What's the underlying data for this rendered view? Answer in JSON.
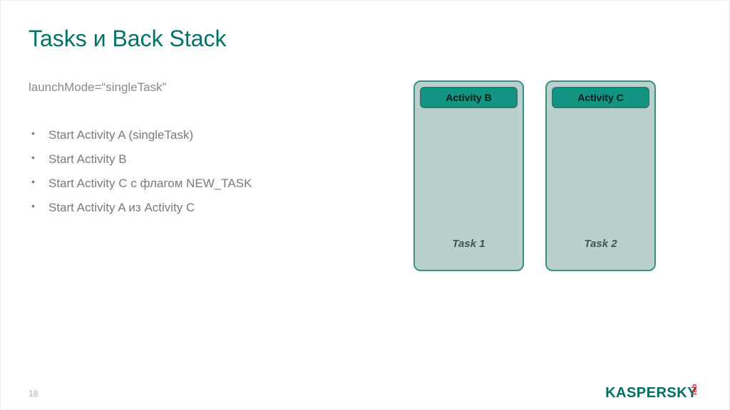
{
  "title": "Tasks и Back Stack",
  "launch_mode": "launchMode=“singleTask”",
  "bullets": [
    "Start Activity A (singleTask)",
    "Start Activity B",
    "Start Activity C с флагом NEW_TASK",
    "Start Activity A из Activity C"
  ],
  "tasks": [
    {
      "activity": "Activity B",
      "label": "Task 1"
    },
    {
      "activity": "Activity C",
      "label": "Task 2"
    }
  ],
  "page_number": "18",
  "logo": {
    "brand": "KASPERSKY",
    "lab": "lab"
  },
  "colors": {
    "title": "#007166",
    "task_bg": "#b8d1cc",
    "task_border": "#3b8f85",
    "chip_bg": "#139483",
    "logo_red": "#d22927"
  }
}
